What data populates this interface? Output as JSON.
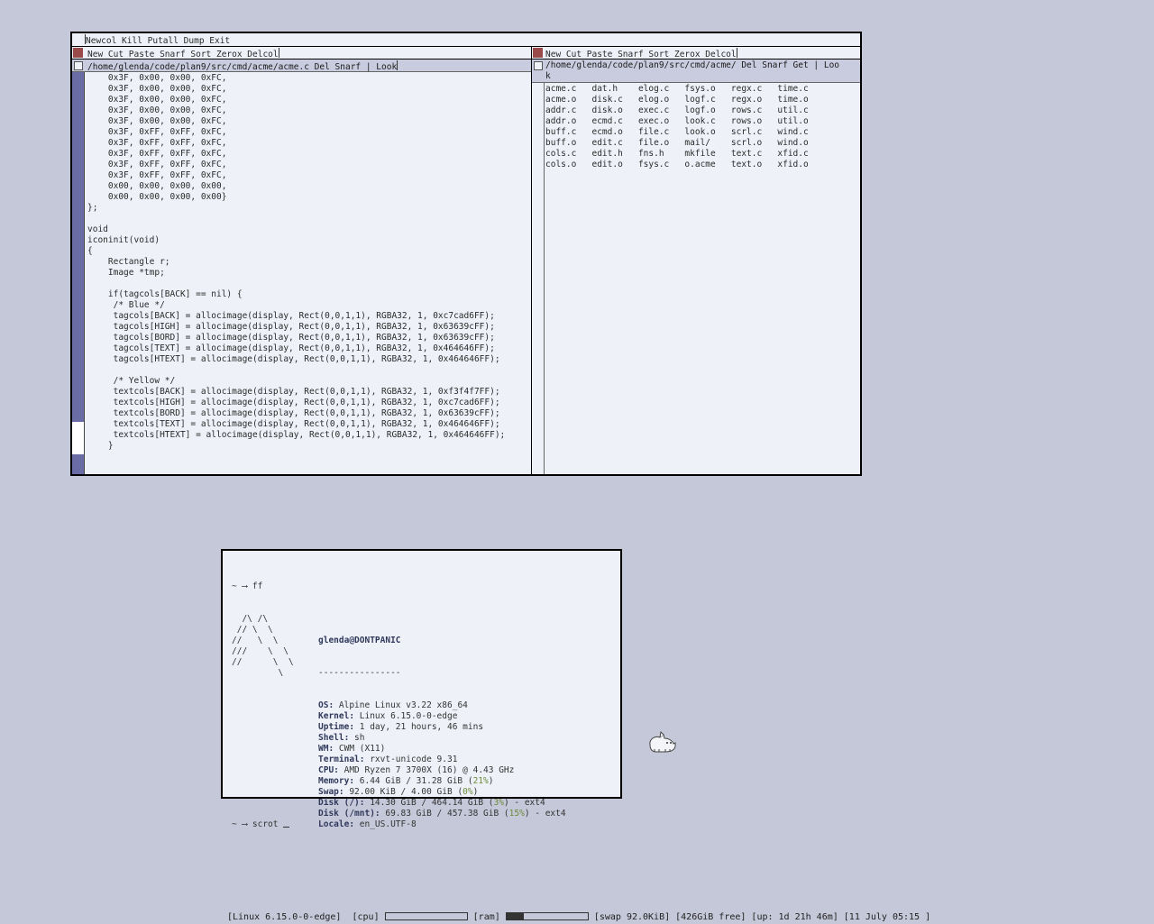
{
  "acme": {
    "main_tag": "Newcol Kill Putall Dump Exit",
    "column_tag": "New Cut Paste Snarf Sort Zerox Delcol",
    "left": {
      "window_tag": "/home/glenda/code/plan9/src/cmd/acme/acme.c Del Snarf | Look",
      "scroll_thumb_fraction": 0.08,
      "lines": [
        "    0x3F, 0x00, 0x00, 0xFC,",
        "    0x3F, 0x00, 0x00, 0xFC,",
        "    0x3F, 0x00, 0x00, 0xFC,",
        "    0x3F, 0x00, 0x00, 0xFC,",
        "    0x3F, 0x00, 0x00, 0xFC,",
        "    0x3F, 0xFF, 0xFF, 0xFC,",
        "    0x3F, 0xFF, 0xFF, 0xFC,",
        "    0x3F, 0xFF, 0xFF, 0xFC,",
        "    0x3F, 0xFF, 0xFF, 0xFC,",
        "    0x3F, 0xFF, 0xFF, 0xFC,",
        "    0x00, 0x00, 0x00, 0x00,",
        "    0x00, 0x00, 0x00, 0x00}",
        "};",
        "",
        "void",
        "iconinit(void)",
        "{",
        "    Rectangle r;",
        "    Image *tmp;",
        "",
        "    if(tagcols[BACK] == nil) {",
        "     /* Blue */",
        "     tagcols[BACK] = allocimage(display, Rect(0,0,1,1), RGBA32, 1, 0xc7cad6FF);",
        "     tagcols[HIGH] = allocimage(display, Rect(0,0,1,1), RGBA32, 1, 0x63639cFF);",
        "     tagcols[BORD] = allocimage(display, Rect(0,0,1,1), RGBA32, 1, 0x63639cFF);",
        "     tagcols[TEXT] = allocimage(display, Rect(0,0,1,1), RGBA32, 1, 0x464646FF);",
        "     tagcols[HTEXT] = allocimage(display, Rect(0,0,1,1), RGBA32, 1, 0x464646FF);",
        "",
        "     /* Yellow */",
        "     textcols[BACK] = allocimage(display, Rect(0,0,1,1), RGBA32, 1, 0xf3f4f7FF);",
        "     textcols[HIGH] = allocimage(display, Rect(0,0,1,1), RGBA32, 1, 0xc7cad6FF);",
        "     textcols[BORD] = allocimage(display, Rect(0,0,1,1), RGBA32, 1, 0x63639cFF);",
        "     textcols[TEXT] = allocimage(display, Rect(0,0,1,1), RGBA32, 1, 0x464646FF);",
        "     textcols[HTEXT] = allocimage(display, Rect(0,0,1,1), RGBA32, 1, 0x464646FF);",
        "    }"
      ]
    },
    "right": {
      "window_tag": "/home/glenda/code/plan9/src/cmd/acme/ Del Snarf Get | Loo\nk",
      "files": [
        "acme.c   dat.h    elog.c   fsys.o   regx.c   time.c",
        "acme.o   disk.c   elog.o   logf.c   regx.o   time.o",
        "addr.c   disk.o   exec.c   logf.o   rows.c   util.c",
        "addr.o   ecmd.c   exec.o   look.c   rows.o   util.o",
        "buff.c   ecmd.o   file.c   look.o   scrl.c   wind.c",
        "buff.o   edit.c   file.o   mail/    scrl.o   wind.o",
        "cols.c   edit.h   fns.h    mkfile   text.c   xfid.c",
        "cols.o   edit.o   fsys.c   o.acme   text.o   xfid.o"
      ]
    }
  },
  "terminal": {
    "prompt1": "~ ⟶ ff",
    "logo": [
      "  /\\ /\\",
      " // \\  \\",
      "//   \\  \\",
      "///    \\  \\",
      "//      \\  \\",
      "         \\"
    ],
    "user_host": "glenda@DONTPANIC",
    "separator": "----------------",
    "info": [
      {
        "key": "OS",
        "value": " Alpine Linux v3.22 x86_64"
      },
      {
        "key": "Kernel",
        "value": " Linux 6.15.0-0-edge"
      },
      {
        "key": "Uptime",
        "value": " 1 day, 21 hours, 46 mins"
      },
      {
        "key": "Shell",
        "value": " sh"
      },
      {
        "key": "WM",
        "value": " CWM (X11)"
      },
      {
        "key": "Terminal",
        "value": " rxvt-unicode 9.31"
      },
      {
        "key": "CPU",
        "value": " AMD Ryzen 7 3700X (16) @ 4.43 GHz"
      },
      {
        "key": "Memory",
        "value": " 6.44 GiB / 31.28 GiB (",
        "pct": "21%",
        "tail": ")"
      },
      {
        "key": "Swap",
        "value": " 92.00 KiB / 4.00 GiB (",
        "pct": "0%",
        "tail": ")"
      },
      {
        "key": "Disk (/)",
        "value": " 14.30 GiB / 464.14 GiB (",
        "pct": "3%",
        "tail": ") - ext4"
      },
      {
        "key": "Disk (/mnt)",
        "value": " 69.83 GiB / 457.38 GiB (",
        "pct": "15%",
        "tail": ") - ext4"
      },
      {
        "key": "Locale",
        "value": " en_US.UTF-8"
      }
    ],
    "prompt2": "~ ⟶ scrot "
  },
  "statusbar": {
    "kernel": "[Linux 6.15.0-0-edge]",
    "cpu_label": "[cpu]",
    "cpu_fraction": 0.0,
    "ram_label": "[ram]",
    "ram_fraction": 0.21,
    "rest": "[swap 92.0KiB] [426GiB free] [up: 1d 21h 46m] [11 July 05:15 ]"
  },
  "colors": {
    "desktop": "#c5c8d8",
    "acme_tag": "#c9ccdf",
    "acme_body": "#eef2f8",
    "scrollbar": "#6a6ca6",
    "modified_box": "#9b4a4a",
    "accent_green": "#6b8a3a"
  }
}
